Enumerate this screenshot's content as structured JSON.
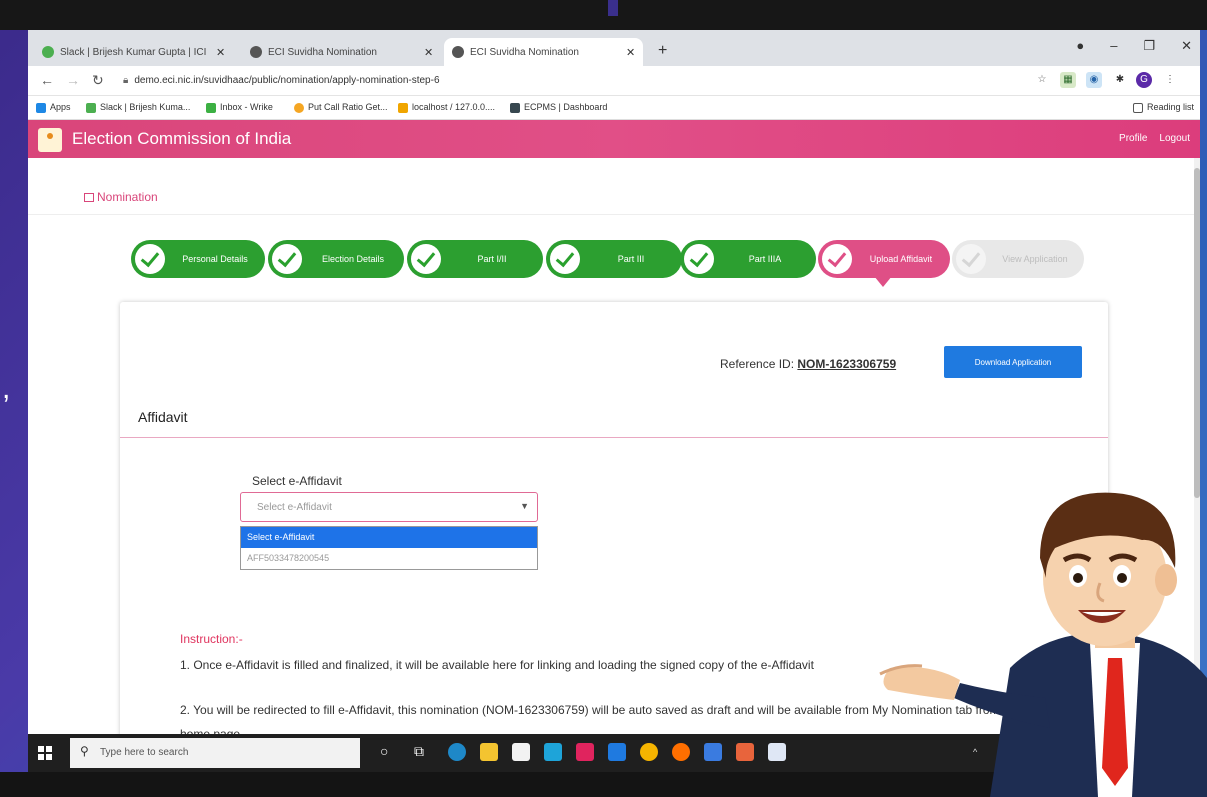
{
  "browser": {
    "tabs": [
      {
        "title": "Slack | Brijesh Kumar Gupta | ICI",
        "favicon_color": "#4caf50"
      },
      {
        "title": "ECI Suvidha Nomination",
        "favicon_color": "#555555"
      },
      {
        "title": "ECI Suvidha Nomination",
        "favicon_color": "#555555"
      }
    ],
    "url": "demo.eci.nic.in/suvidhaac/public/nomination/apply-nomination-step-6",
    "bookmarks": [
      "Apps",
      "Slack | Brijesh Kuma...",
      "Inbox - Wrike",
      "Put Call Ratio Get...",
      "localhost / 127.0.0....",
      "ECPMS | Dashboard"
    ],
    "reading_list": "Reading list"
  },
  "app": {
    "title": "Election Commission of India",
    "profile": "Profile",
    "logout": "Logout",
    "breadcrumb": "Nomination",
    "accent_color": "#df4f86"
  },
  "steps": [
    {
      "label": "Personal Details",
      "status": "done"
    },
    {
      "label": "Election Details",
      "status": "done"
    },
    {
      "label": "Part I/II",
      "status": "done"
    },
    {
      "label": "Part III",
      "status": "done"
    },
    {
      "label": "Part IIIA",
      "status": "done"
    },
    {
      "label": "Upload Affidavit",
      "status": "active"
    },
    {
      "label": "View Application",
      "status": "pending"
    }
  ],
  "card": {
    "reference_label": "Reference ID:",
    "reference_id": "NOM-1623306759",
    "download_button": "Download Application",
    "section_title": "Affidavit",
    "select_label": "Select e-Affidavit",
    "select_value": "Select e-Affidavit",
    "options": [
      "Select e-Affidavit",
      "AFF5033478200545"
    ],
    "instruction_heading": "Instruction:-",
    "instruction_1": "1. Once e-Affidavit is filled and finalized, it will be available here for linking and loading the signed copy of the e-Affidavit",
    "instruction_2": "2. You will be redirected to fill e-Affidavit, this nomination (NOM-1623306759) will be auto saved as draft and will be available from My Nomination tab from the home page."
  },
  "taskbar": {
    "search_placeholder": "Type here to search"
  }
}
